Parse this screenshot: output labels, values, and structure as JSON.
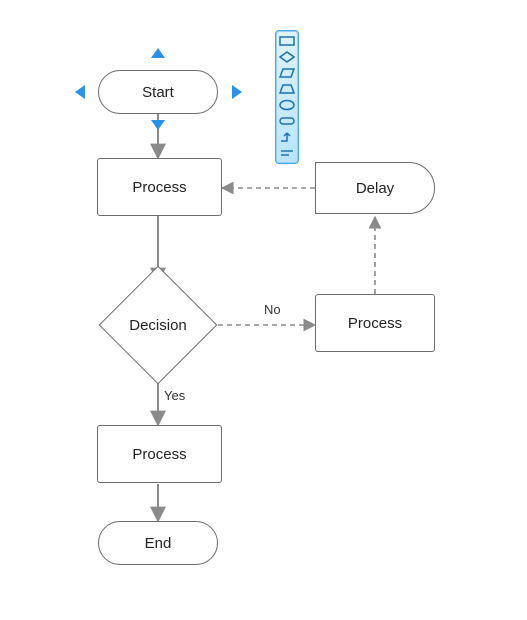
{
  "nodes": {
    "start": {
      "label": "Start"
    },
    "p1": {
      "label": "Process"
    },
    "decision": {
      "label": "Decision"
    },
    "p2": {
      "label": "Process"
    },
    "end": {
      "label": "End"
    },
    "p3": {
      "label": "Process"
    },
    "delay": {
      "label": "Delay"
    }
  },
  "edge_labels": {
    "no": "No",
    "yes": "Yes"
  },
  "toolbar": {
    "tools": [
      {
        "name": "rectangle"
      },
      {
        "name": "diamond"
      },
      {
        "name": "parallelogram"
      },
      {
        "name": "trapezoid"
      },
      {
        "name": "ellipse"
      },
      {
        "name": "terminator"
      },
      {
        "name": "connector"
      },
      {
        "name": "text"
      }
    ]
  },
  "colors": {
    "node_border": "#6b6b6b",
    "arrow": "#8a8a8a",
    "selection": "#2991ea",
    "toolbar_border": "#4aa7e6",
    "toolbar_icon": "#1a72b8"
  },
  "selection": {
    "node": "start"
  }
}
